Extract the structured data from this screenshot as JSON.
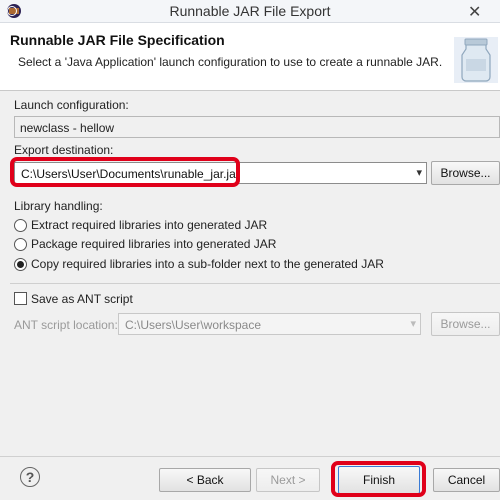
{
  "window": {
    "title": "Runnable JAR File Export",
    "close_glyph": "✕"
  },
  "header": {
    "title": "Runnable JAR File Specification",
    "description": "Select a 'Java Application' launch configuration to use to create a runnable JAR."
  },
  "launch": {
    "label": "Launch configuration:",
    "value": "newclass - hellow"
  },
  "export": {
    "label": "Export destination:",
    "value": "C:\\Users\\User\\Documents\\runable_jar.jar",
    "browse_label": "Browse..."
  },
  "library": {
    "label": "Library handling:",
    "options": [
      {
        "label": "Extract required libraries into generated JAR",
        "selected": false
      },
      {
        "label": "Package required libraries into generated JAR",
        "selected": false
      },
      {
        "label": "Copy required libraries into a sub-folder next to the generated JAR",
        "selected": true
      }
    ]
  },
  "ant": {
    "checkbox_label": "Save as ANT script",
    "checked": false,
    "location_label": "ANT script location:",
    "location_value": "C:\\Users\\User\\workspace",
    "browse_label": "Browse..."
  },
  "footer": {
    "help_glyph": "?",
    "back_label": "< Back",
    "next_label": "Next >",
    "finish_label": "Finish",
    "cancel_label": "Cancel"
  },
  "colors": {
    "highlight": "#e0001a"
  },
  "icons": {
    "app": "eclipse-app-icon",
    "banner": "jar-banner-icon",
    "help": "help-icon",
    "dropdown": "chevron-down-icon"
  }
}
